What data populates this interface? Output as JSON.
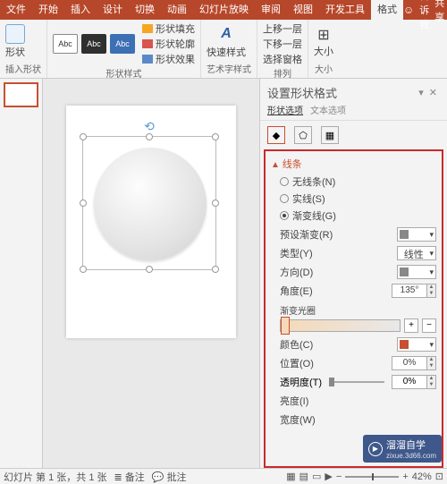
{
  "tabs": [
    "文件",
    "开始",
    "插入",
    "设计",
    "切换",
    "动画",
    "幻灯片放映",
    "审阅",
    "视图",
    "开发工具",
    "格式"
  ],
  "active_tab": 10,
  "tell_me": "告诉我",
  "share": "共享",
  "ribbon": {
    "insert_shape": {
      "label": "插入形状",
      "btn": "形状"
    },
    "shape_styles": {
      "label": "形状样式",
      "abc": "Abc",
      "fill": "形状填充",
      "outline": "形状轮廓",
      "effects": "形状效果"
    },
    "wordart": {
      "label": "艺术字样式",
      "btn": "快速样式"
    },
    "arrange": {
      "label": "排列",
      "bring": "上移一层",
      "send": "下移一层",
      "pane": "选择窗格"
    },
    "size": {
      "label": "大小",
      "btn": "大小"
    }
  },
  "pane": {
    "title": "设置形状格式",
    "sub1": "形状选项",
    "sub2": "文本选项",
    "section": "线条",
    "radio_none": "无线条(N)",
    "radio_solid": "实线(S)",
    "radio_grad": "渐变线(G)",
    "preset": "预设渐变(R)",
    "type": "类型(Y)",
    "type_val": "线性",
    "direction": "方向(D)",
    "angle": "角度(E)",
    "angle_val": "135°",
    "stops": "渐变光圈",
    "color": "颜色(C)",
    "position": "位置(O)",
    "position_val": "0%",
    "transparency": "透明度(T)",
    "transparency_val": "0%",
    "brightness": "亮度(I)",
    "width": "宽度(W)"
  },
  "status": {
    "slide": "幻灯片 第 1 张，共 1 张",
    "notes": "备注",
    "comments": "批注",
    "zoom": "42%"
  },
  "watermark": {
    "brand": "溜溜自学",
    "url": "zixue.3d66.com"
  }
}
